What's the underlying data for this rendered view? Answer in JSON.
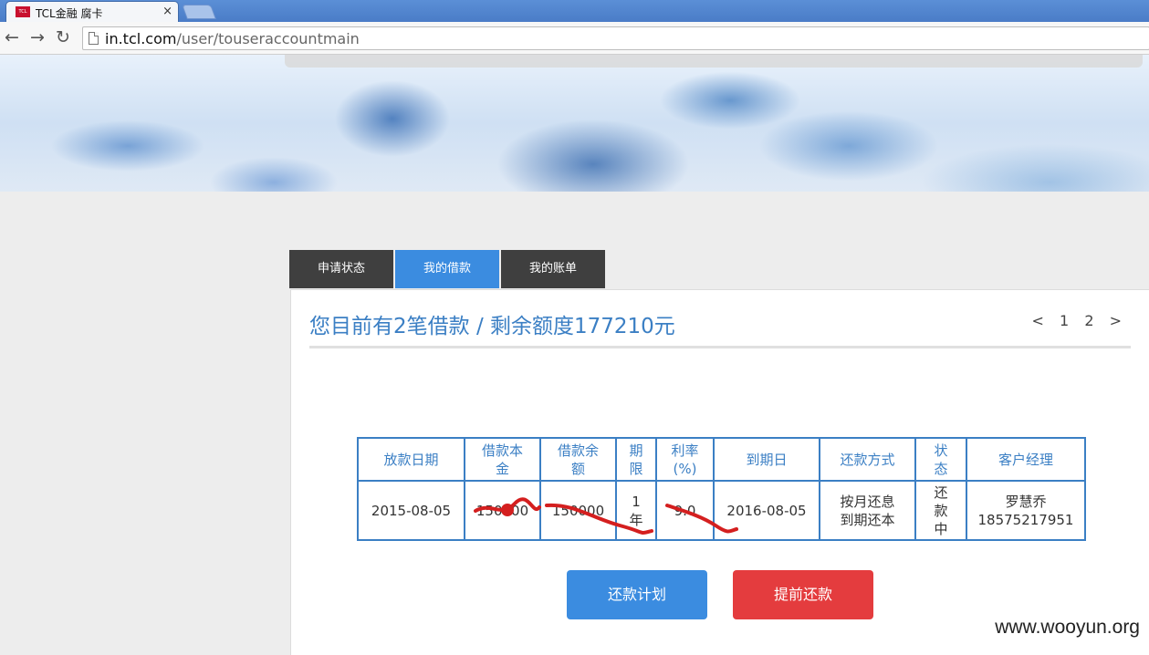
{
  "browser": {
    "tab_title": "TCL金融 腐卡",
    "tab_favicon": "TCL",
    "tab_close": "×",
    "back": "←",
    "forward": "→",
    "reload": "↻",
    "url_host": "in.tcl.com",
    "url_path": "/user/touseraccountmain"
  },
  "tabs": [
    {
      "label": "申请状态",
      "active": false
    },
    {
      "label": "我的借款",
      "active": true
    },
    {
      "label": "我的账单",
      "active": false
    }
  ],
  "panel": {
    "headline": "您目前有2笔借款 / 剩余额度177210元",
    "pager": {
      "prev": "<",
      "pages": [
        "1",
        "2"
      ],
      "next": ">"
    }
  },
  "table": {
    "headers": [
      "放款日期",
      "借款本金",
      "借款余额",
      "期限",
      "利率(%)",
      "到期日",
      "还款方式",
      "状态",
      "客户经理"
    ],
    "row": {
      "date": "2015-08-05",
      "principal": "150000",
      "balance": "150000",
      "term": "1年",
      "rate": "9.0",
      "due": "2016-08-05",
      "method": "按月还息到期还本",
      "status": "还款中",
      "manager_name": "罗慧乔",
      "manager_phone": "18575217951"
    }
  },
  "buttons": {
    "plan": "还款计划",
    "prepay": "提前还款"
  },
  "watermark": "www.wooyun.org",
  "colors": {
    "accent": "#3b8ce0",
    "danger": "#e43c3e",
    "tab_dark": "#3f3f3f",
    "headline": "#3b7fc4"
  }
}
